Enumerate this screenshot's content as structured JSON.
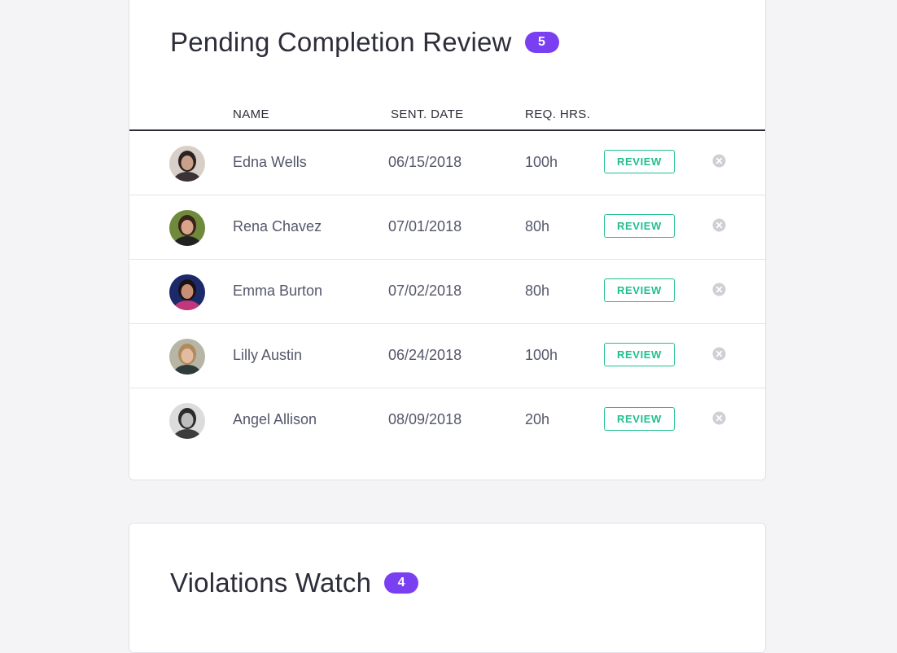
{
  "pending": {
    "title": "Pending Completion Review",
    "count": "5",
    "columns": {
      "name": "NAME",
      "sent_date": "SENT. DATE",
      "req_hrs": "REQ. HRS."
    },
    "rows": [
      {
        "name": "Edna Wells",
        "sent_date": "06/15/2018",
        "req_hrs": "100h",
        "action": "REVIEW",
        "avatar_bg": "#d9cfc9",
        "avatar_hair": "#2a2320",
        "avatar_skin": "#caa08a",
        "avatar_shirt": "#3a3236"
      },
      {
        "name": "Rena Chavez",
        "sent_date": "07/01/2018",
        "req_hrs": "80h",
        "action": "REVIEW",
        "avatar_bg": "#6f8a3c",
        "avatar_hair": "#3a2418",
        "avatar_skin": "#d8a58a",
        "avatar_shirt": "#222222"
      },
      {
        "name": "Emma Burton",
        "sent_date": "07/02/2018",
        "req_hrs": "80h",
        "action": "REVIEW",
        "avatar_bg": "#1c2a6a",
        "avatar_hair": "#1a1212",
        "avatar_skin": "#c98f76",
        "avatar_shirt": "#c2377a"
      },
      {
        "name": "Lilly Austin",
        "sent_date": "06/24/2018",
        "req_hrs": "100h",
        "action": "REVIEW",
        "avatar_bg": "#b7b6a6",
        "avatar_hair": "#b08a5a",
        "avatar_skin": "#e2bba0",
        "avatar_shirt": "#2f3a3a"
      },
      {
        "name": "Angel Allison",
        "sent_date": "08/09/2018",
        "req_hrs": "20h",
        "action": "REVIEW",
        "avatar_bg": "#dcdcdc",
        "avatar_hair": "#2b2b2b",
        "avatar_skin": "#bdbdbd",
        "avatar_shirt": "#3c3c3c"
      }
    ]
  },
  "violations": {
    "title": "Violations Watch",
    "count": "4"
  },
  "colors": {
    "accent_badge": "#7b3ff2",
    "review_green": "#1fbf8f",
    "remove_grey": "#cfcfd6",
    "page_bg": "#f4f4f6"
  },
  "icons": {
    "remove": "close-circle-icon"
  }
}
